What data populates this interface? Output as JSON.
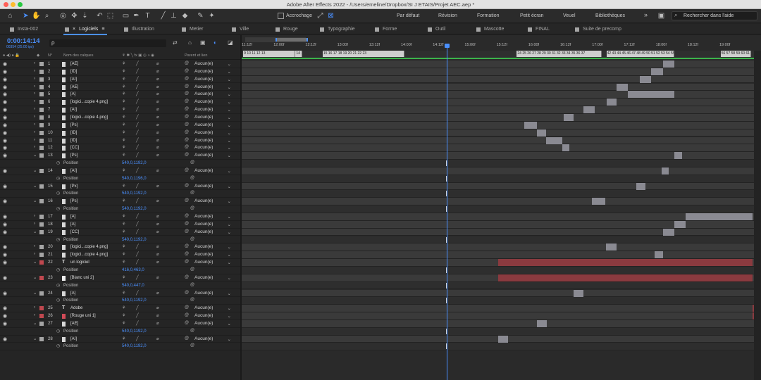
{
  "app": {
    "window_title": "Adobe After Effects 2022 - /Users/emeline/Dropbox/SI J ETAIS/Projet AEC.aep *",
    "traffic_lights": [
      "#ff5f57",
      "#febc2e",
      "#28c840"
    ]
  },
  "toolbar": {
    "tools": [
      "home-icon",
      "selection-icon",
      "hand-icon",
      "zoom-icon",
      "orbit-icon",
      "move-icon",
      "dolly-icon",
      "rotate-icon",
      "region-icon",
      "rectangle-icon",
      "pen-icon",
      "text-icon",
      "brush-icon",
      "clone-icon",
      "eraser-icon",
      "roto-icon",
      "pin-icon"
    ],
    "snap_label": "Accrochage",
    "workspaces": [
      "Par défaut",
      "Révision",
      "Formation",
      "Petit écran",
      "Veuel",
      "Bibliothèques"
    ],
    "more": "»",
    "search_placeholder": "Rechercher dans l'aide"
  },
  "tabs": [
    {
      "label": "Insta-002",
      "color": "#a5a5a5"
    },
    {
      "label": "Logiciels",
      "color": "#a5a5a5",
      "active": true,
      "close": "×",
      "menu": "≡"
    },
    {
      "label": "Illustration",
      "color": "#a5a5a5"
    },
    {
      "label": "Metier",
      "color": "#a5a5a5"
    },
    {
      "label": "Ville",
      "color": "#a5a5a5"
    },
    {
      "label": "Rouge",
      "color": "#a5a5a5"
    },
    {
      "label": "Typographie",
      "color": "#a5a5a5"
    },
    {
      "label": "Forme",
      "color": "#a5a5a5"
    },
    {
      "label": "Outil",
      "color": "#a5a5a5"
    },
    {
      "label": "Mascotte",
      "color": "#a5a5a5"
    },
    {
      "label": "FINAL",
      "color": "#a5a5a5"
    },
    {
      "label": "Suite de precomp",
      "color": "#a5a5a5"
    }
  ],
  "timecode": {
    "current": "0:00:14:14",
    "sub": "00354 (25.00 ips)"
  },
  "search": {
    "placeholder": "ρ"
  },
  "columns": {
    "num": "N°",
    "name": "Nom des calques",
    "parent": "Parent et lien"
  },
  "ruler": [
    "11:12f",
    "12:00f",
    "12:12f",
    "13:00f",
    "13:12f",
    "14:00f",
    "14:12f",
    "15:00f",
    "15:12f",
    "16:00f",
    "16:12f",
    "17:00f",
    "17:12f",
    "18:00f",
    "18:12f",
    "19:00f"
  ],
  "markers": [
    {
      "label": "9 10 11 12 13",
      "start": 0.3,
      "end": 10.5
    },
    {
      "label": "14 15",
      "start": 10.5,
      "end": 11.8
    },
    {
      "label": "15 16 17 18 19 20 21 22 23",
      "start": 15.8,
      "end": 31.8
    },
    {
      "label": "24 25 26 27 28 29 30 31 32 33 34 35 36 37",
      "start": 53.7,
      "end": 70.3
    },
    {
      "label": "42 43 44 45 46 47 48 49 50 51 52 53 54 55",
      "start": 71.2,
      "end": 84.4
    },
    {
      "label": "56 57 58 59 60 61 62",
      "start": 93.5,
      "end": 99.4
    }
  ],
  "parent_default": "Aucun(e)",
  "position_label": "Position",
  "layers": [
    {
      "num": "1",
      "name": "[AE]",
      "label": "#a5a5a5",
      "icon": "file",
      "bar": [
        82.2,
        84.4
      ]
    },
    {
      "num": "2",
      "name": "[ID]",
      "label": "#a5a5a5",
      "icon": "file",
      "bar": [
        79.9,
        82.2
      ]
    },
    {
      "num": "3",
      "name": "[AI]",
      "label": "#a5a5a5",
      "icon": "file",
      "bar": [
        77.7,
        79.9
      ]
    },
    {
      "num": "4",
      "name": "[AE]",
      "label": "#a5a5a5",
      "icon": "file",
      "bar": [
        73.2,
        75.4
      ]
    },
    {
      "num": "5",
      "name": "[A]",
      "label": "#a5a5a5",
      "icon": "file",
      "bar": [
        75.4,
        84.4
      ]
    },
    {
      "num": "6",
      "name": "[logici...copie 4.png]",
      "label": "#a5a5a5",
      "icon": "file",
      "bar": [
        71.2,
        73.2
      ]
    },
    {
      "num": "7",
      "name": "[AI]",
      "label": "#a5a5a5",
      "icon": "file",
      "bar": [
        66.7,
        68.9
      ]
    },
    {
      "num": "8",
      "name": "[logici...copie 4.png]",
      "label": "#a5a5a5",
      "icon": "file",
      "bar": [
        62.9,
        64.8
      ]
    },
    {
      "num": "9",
      "name": "[Ps]",
      "label": "#a5a5a5",
      "icon": "file",
      "bar": [
        55.2,
        57.6
      ]
    },
    {
      "num": "10",
      "name": "[ID]",
      "label": "#a5a5a5",
      "icon": "file",
      "bar": [
        57.6,
        59.4
      ]
    },
    {
      "num": "11",
      "name": "[ID]",
      "label": "#a5a5a5",
      "icon": "file",
      "bar": [
        59.4,
        62.6
      ]
    },
    {
      "num": "12",
      "name": "[CC]",
      "label": "#a5a5a5",
      "icon": "file",
      "bar": [
        62.6,
        64.0
      ]
    },
    {
      "num": "13",
      "name": "[Ps]",
      "label": "#a5a5a5",
      "icon": "file",
      "bar": [
        84.4,
        86.0
      ],
      "expanded": true,
      "prop": "540,0,1192,0"
    },
    {
      "num": "14",
      "name": "[AI]",
      "label": "#a5a5a5",
      "icon": "file",
      "bar": [
        82.0,
        83.4
      ],
      "expanded": true,
      "prop": "540,0,1196,0"
    },
    {
      "num": "15",
      "name": "[Px]",
      "label": "#a5a5a5",
      "icon": "file",
      "bar": [
        77.0,
        78.8
      ],
      "expanded": true,
      "prop": "540,0,1192,0"
    },
    {
      "num": "16",
      "name": "[Ps]",
      "label": "#a5a5a5",
      "icon": "file",
      "bar": [
        68.4,
        71.0
      ],
      "expanded": true,
      "prop": "540,0,1192,0"
    },
    {
      "num": "17",
      "name": "[A]",
      "label": "#a5a5a5",
      "icon": "file",
      "bar": [
        86.7,
        99.7
      ]
    },
    {
      "num": "18",
      "name": "[A]",
      "label": "#a5a5a5",
      "icon": "file",
      "bar": [
        84.4,
        86.7
      ]
    },
    {
      "num": "19",
      "name": "[CC]",
      "label": "#a5a5a5",
      "icon": "file",
      "bar": [
        82.2,
        84.4
      ],
      "expanded": true,
      "prop": "540,0,1192,0"
    },
    {
      "num": "20",
      "name": "[logici...copie 4.png]",
      "label": "#a5a5a5",
      "icon": "file",
      "bar": [
        71.1,
        73.2
      ]
    },
    {
      "num": "21",
      "name": "[logici...copie 4.png]",
      "label": "#a5a5a5",
      "icon": "file",
      "bar": [
        80.6,
        82.2
      ]
    },
    {
      "num": "22",
      "name": "un logiciel",
      "label": "#c0484f",
      "icon": "text",
      "bar": [
        50.0,
        99.7
      ],
      "red": true,
      "expanded": true,
      "prop": "416,0,463,0"
    },
    {
      "num": "23",
      "name": "[Blanc uni 2]",
      "label": "#c0484f",
      "icon": "solid",
      "bar": [
        50.0,
        99.7
      ],
      "red": true,
      "expanded": true,
      "prop": "540,0,447,0"
    },
    {
      "num": "24",
      "name": "[A]",
      "label": "#a5a5a5",
      "icon": "file",
      "bar": [
        64.8,
        66.7
      ],
      "expanded": true,
      "prop": "540,0,1192,0"
    },
    {
      "num": "25",
      "name": "Adobe",
      "label": "#c0484f",
      "icon": "text",
      "bar": [
        99.7,
        106.0
      ],
      "red": true
    },
    {
      "num": "26",
      "name": "[Rouge uni 1]",
      "label": "#c0484f",
      "icon": "red",
      "bar": [
        99.7,
        106.0
      ],
      "red": true
    },
    {
      "num": "27",
      "name": "[AE]",
      "label": "#a5a5a5",
      "icon": "file",
      "bar": [
        57.6,
        59.6
      ],
      "expanded": true,
      "prop": "540,0,1192,0"
    },
    {
      "num": "28",
      "name": "[AI]",
      "label": "#a5a5a5",
      "icon": "file",
      "bar": [
        50.0,
        52.0
      ],
      "expanded": true,
      "prop": "540,0,1192,0"
    }
  ]
}
